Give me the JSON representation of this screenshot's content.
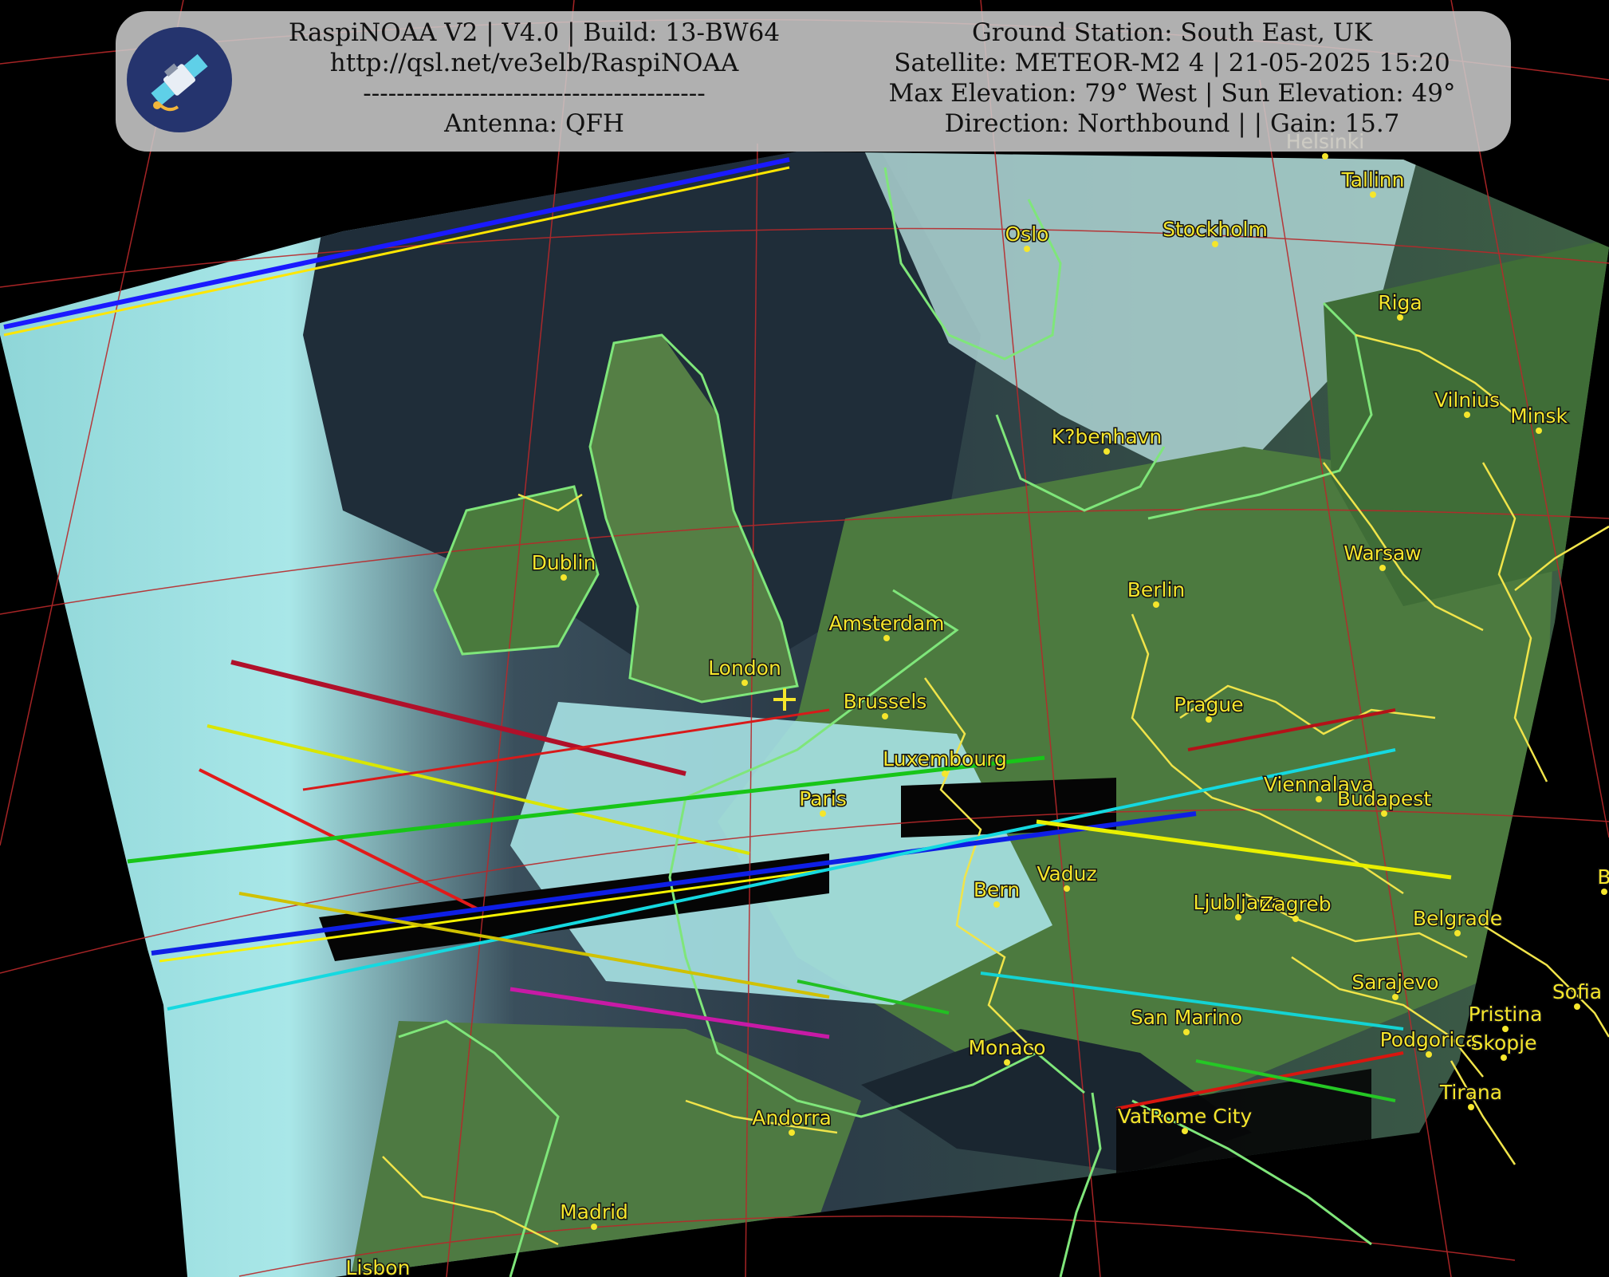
{
  "header": {
    "left_lines": [
      "RaspiNOAA V2 | V4.0 | Build: 13-BW64",
      "http://qsl.net/ve3elb/RaspiNOAA",
      "-----------------------------------------",
      "Antenna: QFH"
    ],
    "right_lines": [
      "Ground Station: South East, UK",
      "Satellite: METEOR-M2 4 | 21-05-2025 15:20",
      "Max Elevation: 79° West | Sun Elevation: 49°",
      "Direction: Northbound | | Gain: 15.7"
    ]
  },
  "cities": [
    {
      "name": "Helsinki",
      "faint": true
    },
    {
      "name": "Tallinn"
    },
    {
      "name": "Oslo"
    },
    {
      "name": "Stockholm"
    },
    {
      "name": "Riga"
    },
    {
      "name": "Vilnius"
    },
    {
      "name": "Minsk"
    },
    {
      "name": "K?benhavn"
    },
    {
      "name": "Dublin"
    },
    {
      "name": "Warsaw"
    },
    {
      "name": "Berlin"
    },
    {
      "name": "Amsterdam"
    },
    {
      "name": "London"
    },
    {
      "name": "Brussels"
    },
    {
      "name": "Prague"
    },
    {
      "name": "Luxembourg"
    },
    {
      "name": "Paris"
    },
    {
      "name": "Viennalava"
    },
    {
      "name": "Budapest"
    },
    {
      "name": "Vaduz"
    },
    {
      "name": "Bern"
    },
    {
      "name": "Ljubljana"
    },
    {
      "name": "Zagreb"
    },
    {
      "name": "Belgrade"
    },
    {
      "name": "Sarajevo"
    },
    {
      "name": "Sofia"
    },
    {
      "name": "Pristina"
    },
    {
      "name": "San Marino"
    },
    {
      "name": "Monaco"
    },
    {
      "name": "Podgorica"
    },
    {
      "name": "Skopje"
    },
    {
      "name": "Tirana"
    },
    {
      "name": "Andorra"
    },
    {
      "name": "VatRome City"
    },
    {
      "name": "Madrid"
    },
    {
      "name": "Lisbon"
    },
    {
      "name": "B"
    }
  ],
  "colors": {
    "label": "#f5e62c",
    "coast": "#7fe67a",
    "border": "#f0e44a",
    "grid": "#b8282a",
    "cloud": "#9fe6e6",
    "land": "#4f7d42",
    "sea": "#1d2a38"
  }
}
